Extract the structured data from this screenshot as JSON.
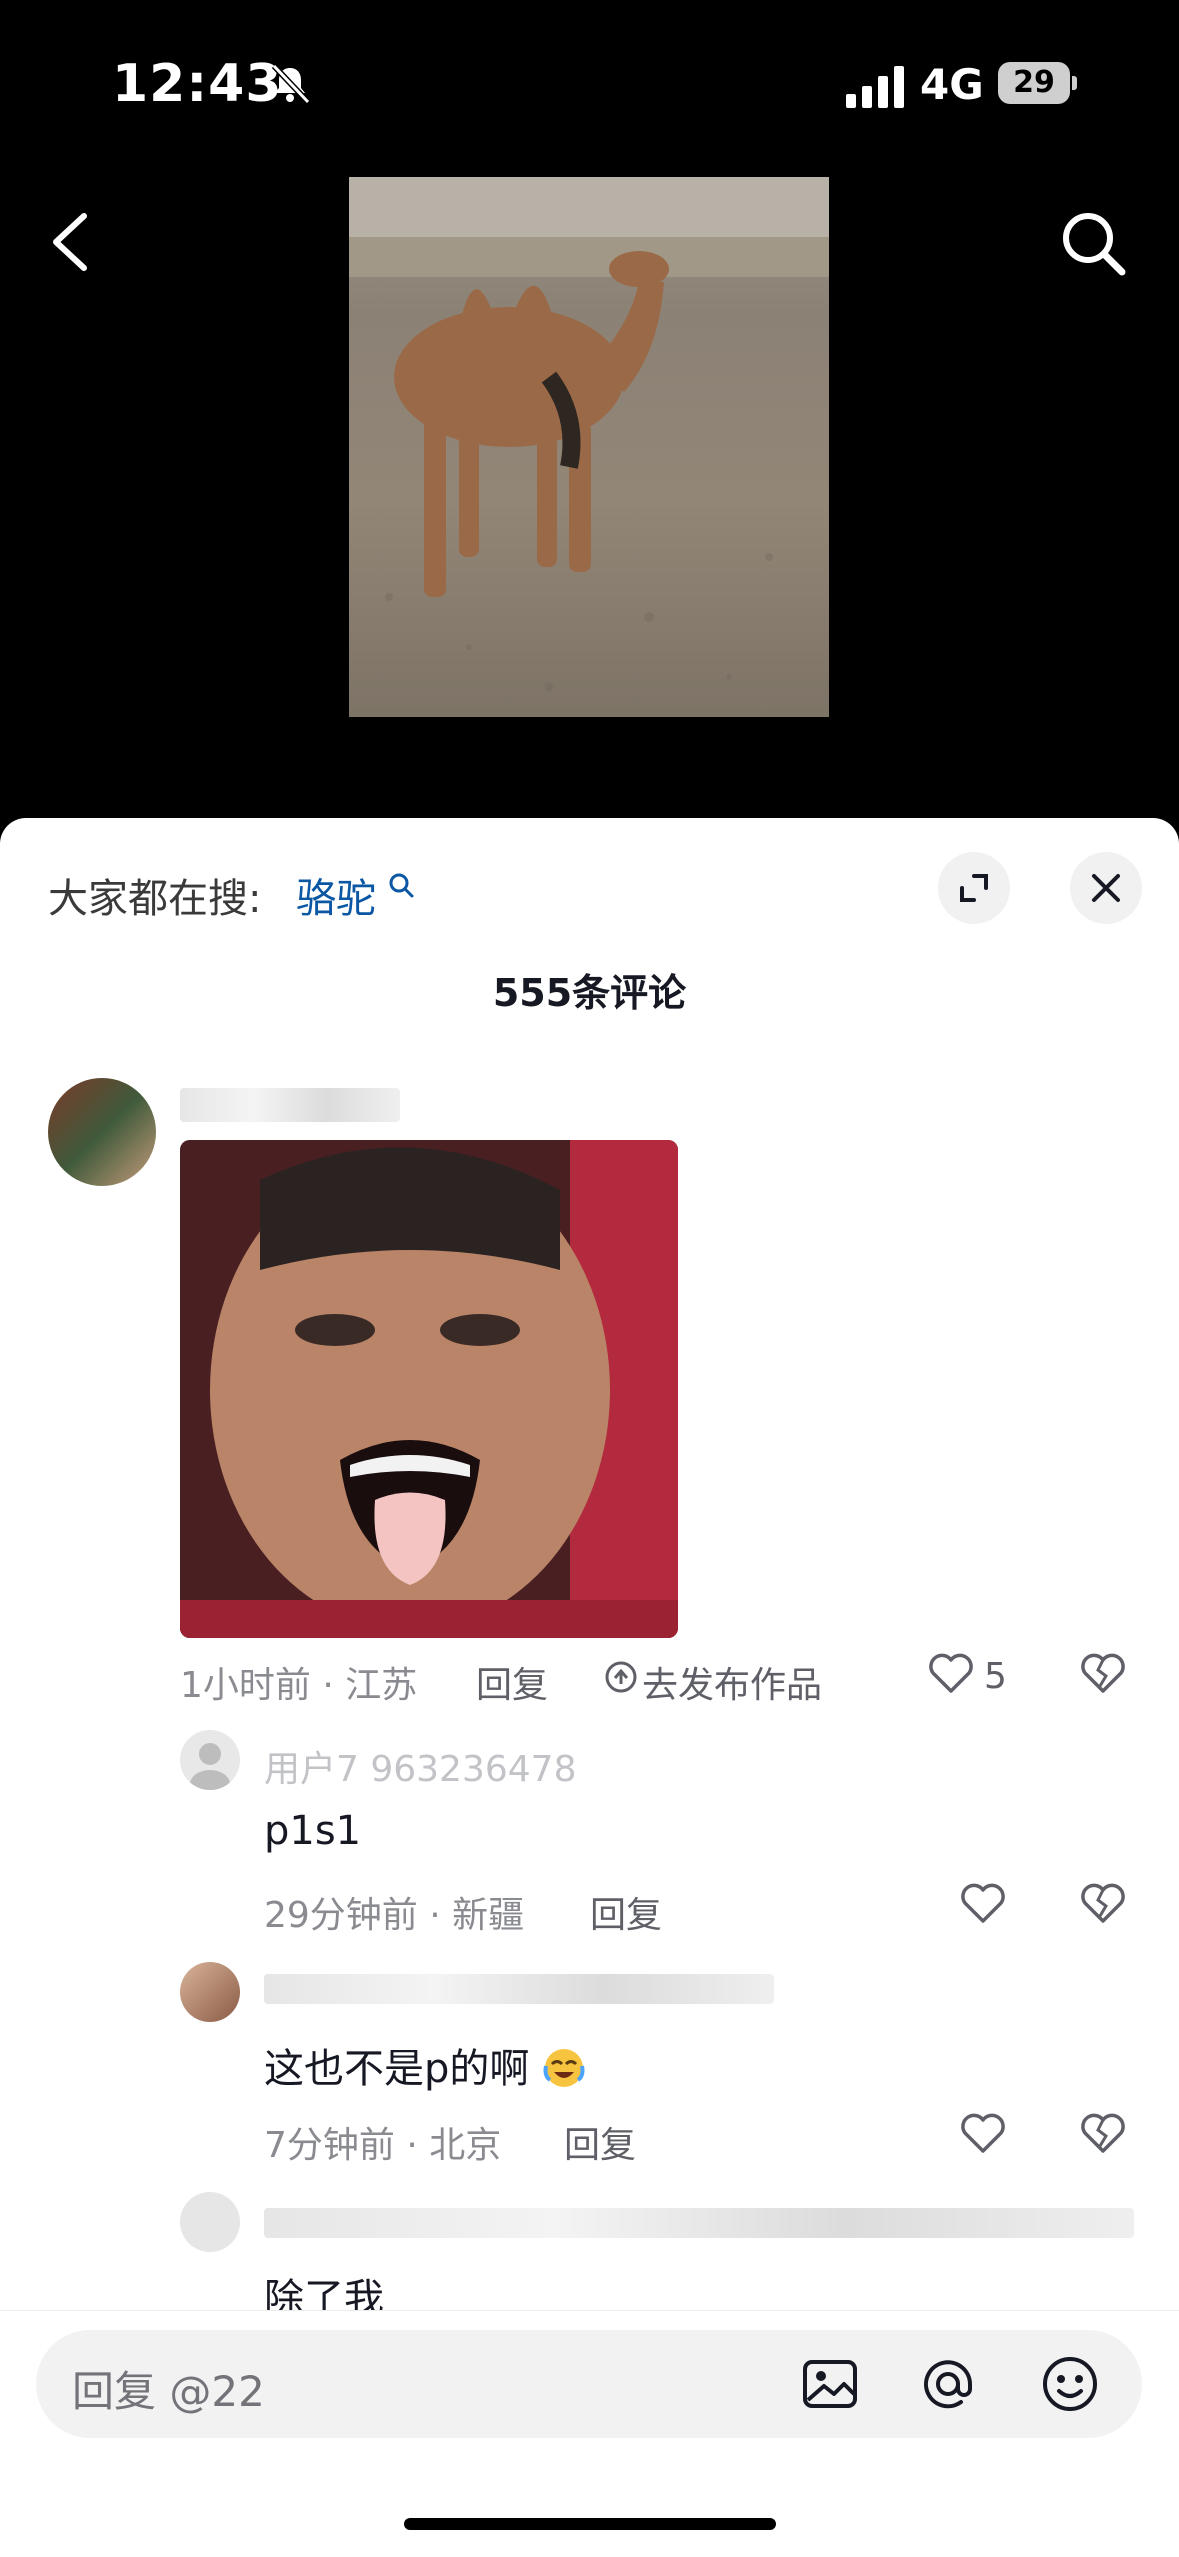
{
  "status_bar": {
    "time": "12:43",
    "network": "4G",
    "battery": "29"
  },
  "search_suggestion": {
    "prefix": "大家都在搜:",
    "keyword": "骆驼"
  },
  "comments_header": {
    "count_label": "555条评论"
  },
  "comments": [
    {
      "meta": "1小时前 · 江苏",
      "reply": "回复",
      "publish": "去发布作品",
      "likes": "5"
    },
    {
      "text": "p1s1",
      "meta": "29分钟前 · 新疆",
      "reply": "回复",
      "username_fragment": "用户7 963236478"
    },
    {
      "text": "这也不是p的啊",
      "meta": "7分钟前 · 北京",
      "reply": "回复"
    },
    {
      "text": "除了我"
    }
  ],
  "reply_input": {
    "placeholder": "回复 @22"
  },
  "colors": {
    "keyword": "#0b57a4",
    "sheet": "#ffffff",
    "background": "#000000"
  },
  "icons": [
    "bell-muted-icon",
    "signal-icon",
    "battery-icon",
    "back-icon",
    "search-icon",
    "expand-icon",
    "close-icon",
    "heart-icon",
    "broken-heart-icon",
    "image-icon",
    "at-icon",
    "emoji-icon"
  ]
}
